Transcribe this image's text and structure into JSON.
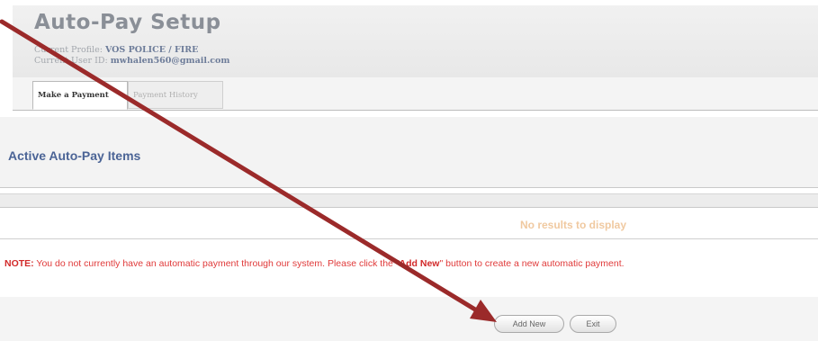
{
  "header": {
    "title": "Auto-Pay Setup",
    "profile_label": "Current Profile:",
    "profile_value": "VOS POLICE / FIRE",
    "user_label": "Current User ID:",
    "user_value": "mwhalen560@gmail.com"
  },
  "tabs": [
    {
      "label": "Make a Payment",
      "active": true
    },
    {
      "label": "Payment History",
      "active": false
    }
  ],
  "section": {
    "title": "Active Auto-Pay Items"
  },
  "results": {
    "empty_text": "No results to display"
  },
  "note": {
    "prefix": "NOTE:",
    "text_before": " You do not currently have an automatic payment through our system. Please click the \"",
    "highlight": "Add New",
    "text_after": "\" button to create a new automatic payment."
  },
  "buttons": {
    "add_new": "Add New",
    "exit": "Exit"
  },
  "colors": {
    "title": "#8a8f97",
    "section_title": "#4b6496",
    "note": "#e03a3a",
    "no_results": "#f0c9a0",
    "arrow": "#9b2a2a"
  }
}
